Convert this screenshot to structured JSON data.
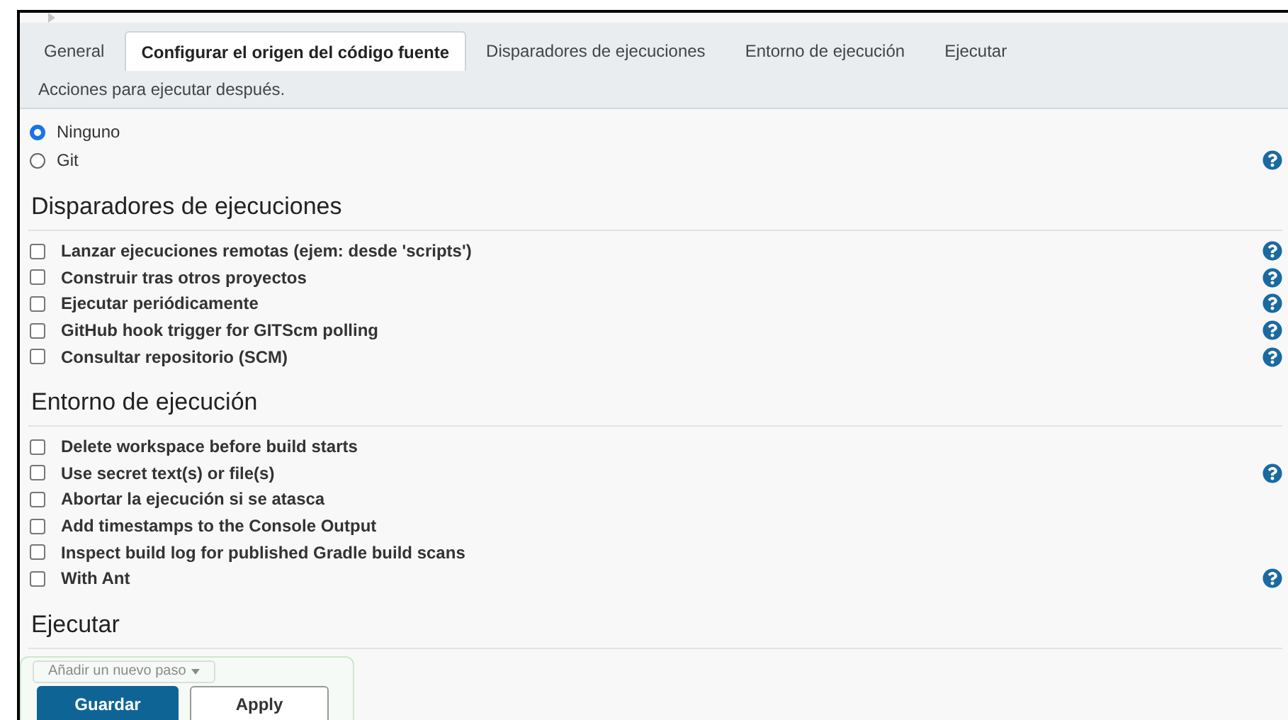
{
  "tabs": [
    {
      "label": "General",
      "selected": false
    },
    {
      "label": "Configurar el origen del código fuente",
      "selected": true
    },
    {
      "label": "Disparadores de ejecuciones",
      "selected": false
    },
    {
      "label": "Entorno de ejecución",
      "selected": false
    },
    {
      "label": "Ejecutar",
      "selected": false
    },
    {
      "label": "Acciones para ejecutar después.",
      "selected": false
    }
  ],
  "scm": [
    {
      "label": "Ninguno",
      "selected": true,
      "help": false
    },
    {
      "label": "Git",
      "selected": false,
      "help": true
    }
  ],
  "sections": [
    {
      "title": "Disparadores de ejecuciones",
      "options": [
        {
          "label": "Lanzar ejecuciones remotas (ejem: desde 'scripts')",
          "checked": false,
          "help": true
        },
        {
          "label": "Construir tras otros proyectos",
          "checked": false,
          "help": true
        },
        {
          "label": "Ejecutar periódicamente",
          "checked": false,
          "help": true
        },
        {
          "label": "GitHub hook trigger for GITScm polling",
          "checked": false,
          "help": true
        },
        {
          "label": "Consultar repositorio (SCM)",
          "checked": false,
          "help": true
        }
      ]
    },
    {
      "title": "Entorno de ejecución",
      "options": [
        {
          "label": "Delete workspace before build starts",
          "checked": false,
          "help": false
        },
        {
          "label": "Use secret text(s) or file(s)",
          "checked": false,
          "help": true
        },
        {
          "label": "Abortar la ejecución si se atasca",
          "checked": false,
          "help": false
        },
        {
          "label": "Add timestamps to the Console Output",
          "checked": false,
          "help": false
        },
        {
          "label": "Inspect build log for published Gradle build scans",
          "checked": false,
          "help": false
        },
        {
          "label": "With Ant",
          "checked": false,
          "help": true
        }
      ]
    },
    {
      "title": "Ejecutar"
    }
  ],
  "add_step": {
    "label": "Añadir un nuevo paso"
  },
  "buttons": [
    {
      "label": "Guardar",
      "kind": "primary"
    },
    {
      "label": "Apply",
      "kind": "secondary"
    }
  ]
}
